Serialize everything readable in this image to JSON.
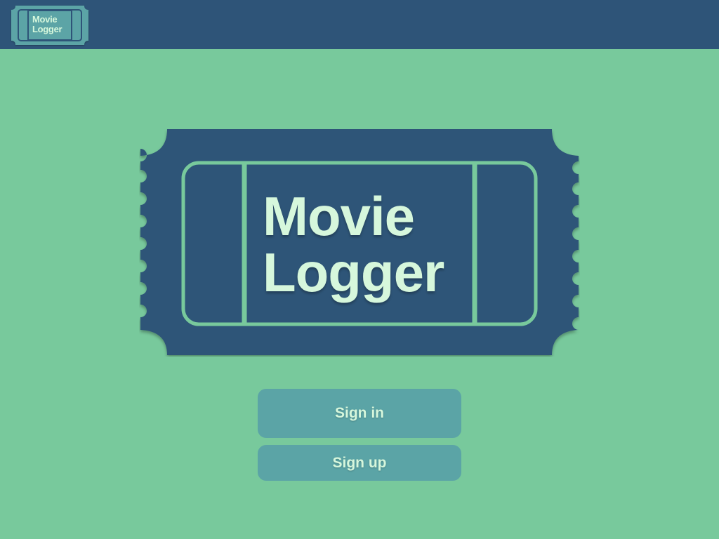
{
  "header": {
    "logo": {
      "line1": "Movie",
      "line2": "Logger",
      "icon": "ticket-icon"
    }
  },
  "hero": {
    "title_line1": "Movie",
    "title_line2": "Logger",
    "icon": "ticket-icon"
  },
  "actions": {
    "sign_in_label": "Sign in",
    "sign_up_label": "Sign up"
  },
  "colors": {
    "background": "#78c99c",
    "header": "#2e5478",
    "ticket": "#2e5478",
    "ticket_outline": "#78c99c",
    "button": "#5ba4a6",
    "text_light": "#d6f7dc"
  }
}
